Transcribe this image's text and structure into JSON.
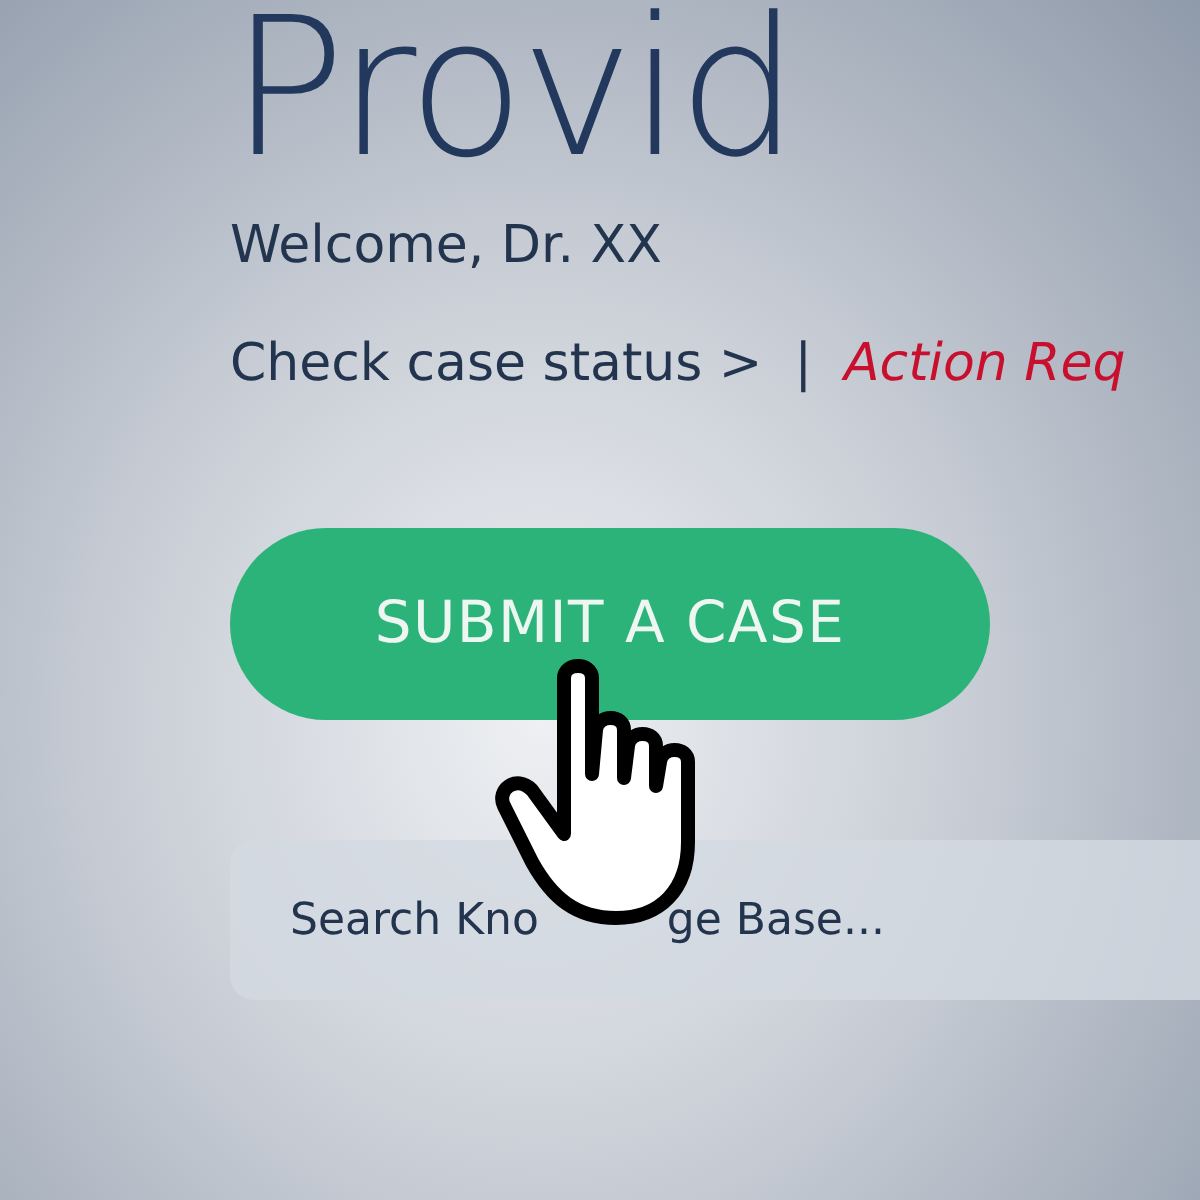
{
  "title": "Provid",
  "welcome": "Welcome, Dr. XX",
  "links": [
    {
      "kind": "link",
      "text": "Check case status >"
    },
    {
      "kind": "separator",
      "text": "|"
    },
    {
      "kind": "alert",
      "text": "Action Req"
    }
  ],
  "submit_button": "SUBMIT A CASE",
  "search": {
    "placeholder_parts": [
      "Search Kno",
      "ge Base..."
    ]
  }
}
